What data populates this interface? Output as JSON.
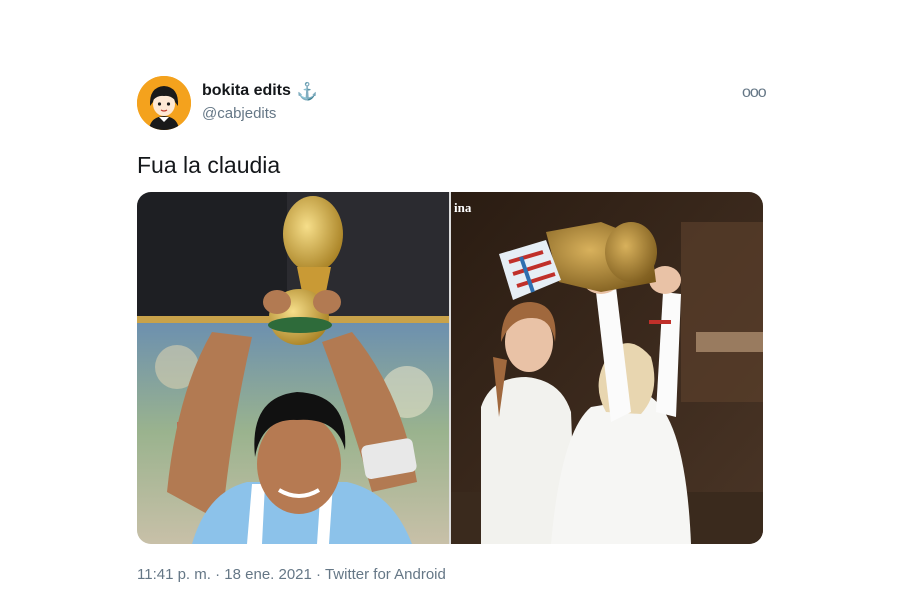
{
  "tweet": {
    "author_name": "bokita edits",
    "author_badge": "anchor-icon",
    "handle": "@cabjedits",
    "text": "Fua la claudia",
    "watermark": "ina",
    "timestamp": "11:41 p. m.",
    "date": "18 ene. 2021",
    "source": "Twitter for Android",
    "separator": "·",
    "more_label": "ooo"
  },
  "colors": {
    "avatar_bg": "#f4a21d",
    "badge": "#1da1f2",
    "muted": "#657786"
  }
}
